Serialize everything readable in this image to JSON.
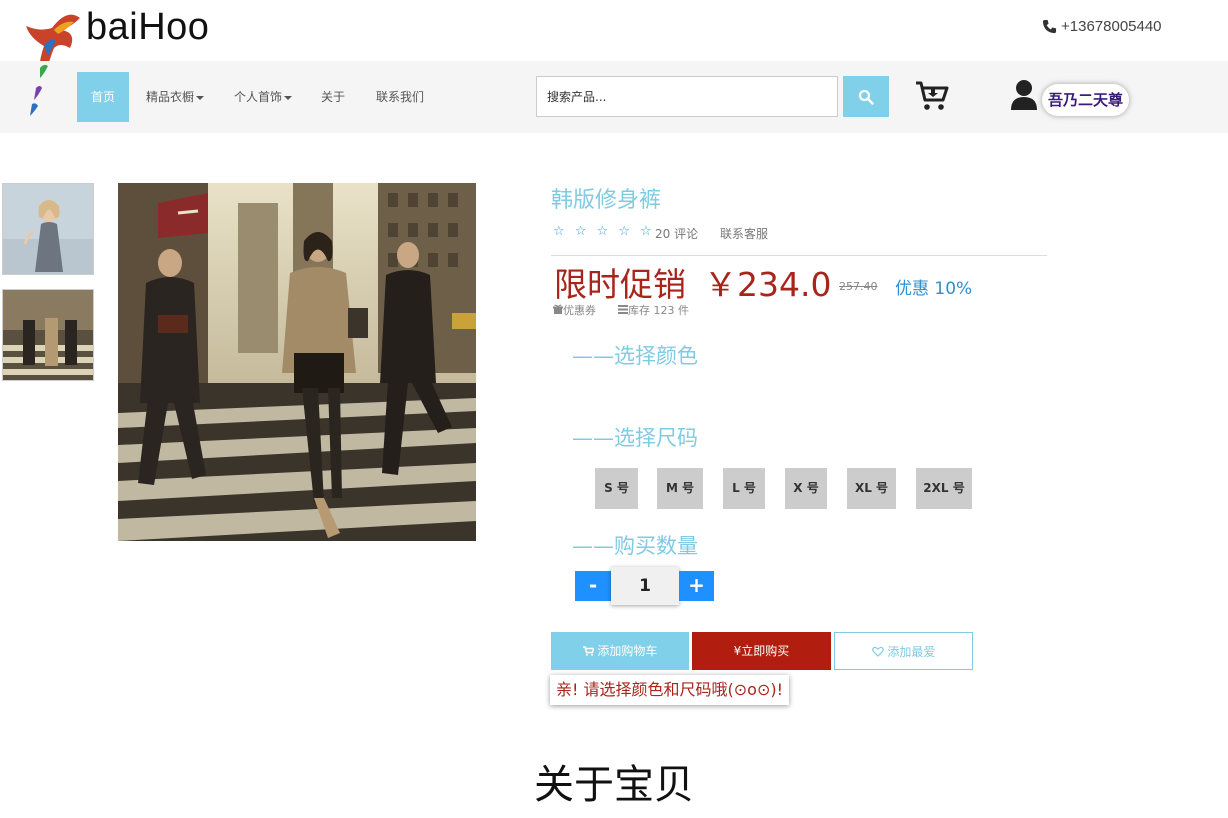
{
  "header": {
    "brand": "baiHoo",
    "phone": "+13678005440",
    "logo_icon": "phoenix-logo-icon"
  },
  "nav": {
    "items": [
      {
        "label": "首页"
      },
      {
        "label": "精品衣橱"
      },
      {
        "label": "个人首饰"
      },
      {
        "label": "关于"
      },
      {
        "label": "联系我们"
      }
    ],
    "search_placeholder": "搜索产品...",
    "user_name": "吾乃二天尊"
  },
  "product": {
    "title": "韩版修身裤",
    "stars": "☆ ☆ ☆ ☆ ☆",
    "reviews": "20 评论",
    "service": "联系客服",
    "promo_label": "限时促销",
    "price": "￥234.0",
    "old_price": "257.40",
    "discount": "优惠 10%",
    "coupon": "优惠券",
    "stock": "库存 123 件",
    "color_title": "——选择颜色",
    "size_title": "——选择尺码",
    "sizes": [
      "S 号",
      "M 号",
      "L 号",
      "X 号",
      "XL 号",
      "2XL 号"
    ],
    "qty_title": "——购买数量",
    "qty_minus": "-",
    "qty_value": "1",
    "qty_plus": "+",
    "add_cart": "添加购物车",
    "buy_now": "¥立即购买",
    "add_fav": "添加最爱",
    "tip": "亲! 请选择颜色和尺码哦(⊙o⊙)!"
  },
  "about_title": "关于宝贝",
  "colors": {
    "accent": "#7fd0e8",
    "price_red": "#a8251c",
    "buy_red": "#b11e10",
    "qty_blue": "#1e90ff"
  }
}
